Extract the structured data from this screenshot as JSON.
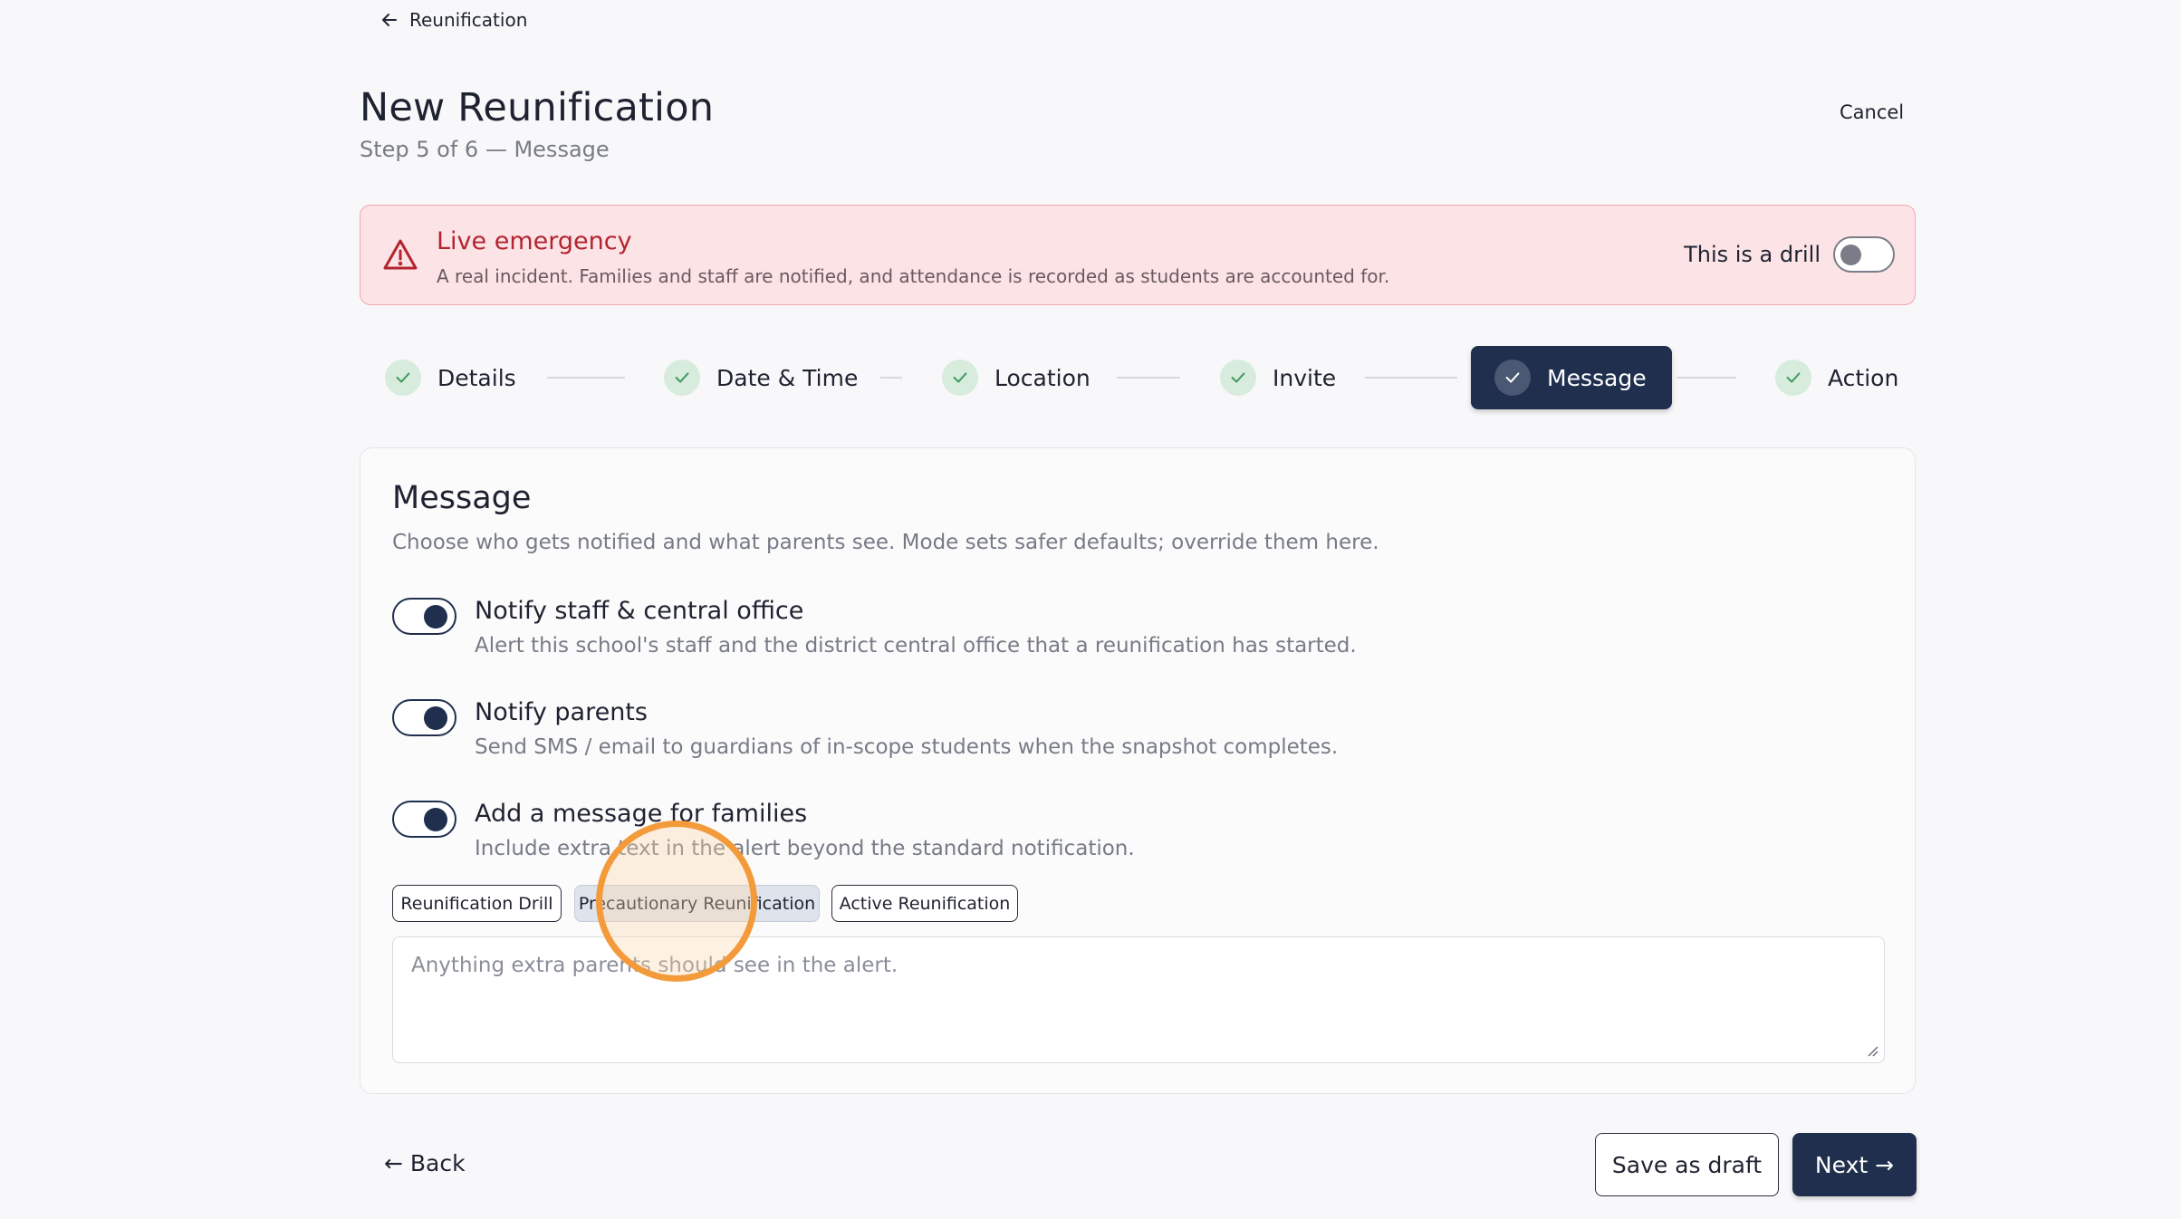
{
  "nav": {
    "back_label": "Reunification"
  },
  "header": {
    "title": "New Reunification",
    "subtitle": "Step 5 of 6 — Message",
    "cancel_label": "Cancel"
  },
  "banner": {
    "title": "Live emergency",
    "description": "A real incident. Families and staff are notified, and attendance is recorded as students are accounted for.",
    "drill_label": "This is a drill",
    "drill_enabled": false,
    "icon": "warning-triangle-icon"
  },
  "steps": [
    {
      "label": "Details",
      "completed": true
    },
    {
      "label": "Date & Time",
      "completed": true
    },
    {
      "label": "Location",
      "completed": true
    },
    {
      "label": "Invite",
      "completed": true
    },
    {
      "label": "Message",
      "completed": true,
      "active": true
    },
    {
      "label": "Action",
      "completed": true
    }
  ],
  "message": {
    "title": "Message",
    "description": "Choose who gets notified and what parents see. Mode sets safer defaults; override them here.",
    "options": [
      {
        "title": "Notify staff & central office",
        "description": "Alert this school's staff and the district central office that a reunification has started.",
        "enabled": true
      },
      {
        "title": "Notify parents",
        "description": "Send SMS / email to guardians of in-scope students when the snapshot completes.",
        "enabled": true
      },
      {
        "title": "Add a message for families",
        "description": "Include extra text in the alert beyond the standard notification.",
        "enabled": true
      }
    ],
    "templates": [
      "Reunification Drill",
      "Precautionary Reunification",
      "Active Reunification"
    ],
    "selected_template": "Precautionary Reunification",
    "textarea_placeholder": "Anything extra parents should see in the alert."
  },
  "footer": {
    "back_label": "← Back",
    "draft_label": "Save as draft",
    "next_label": "Next →"
  },
  "colors": {
    "primary": "#1f2f4d",
    "danger": "#b3242f",
    "banner_bg": "#fbe3e6",
    "success_bg": "#d8ecde",
    "cursor_ring": "#f39a3b"
  }
}
